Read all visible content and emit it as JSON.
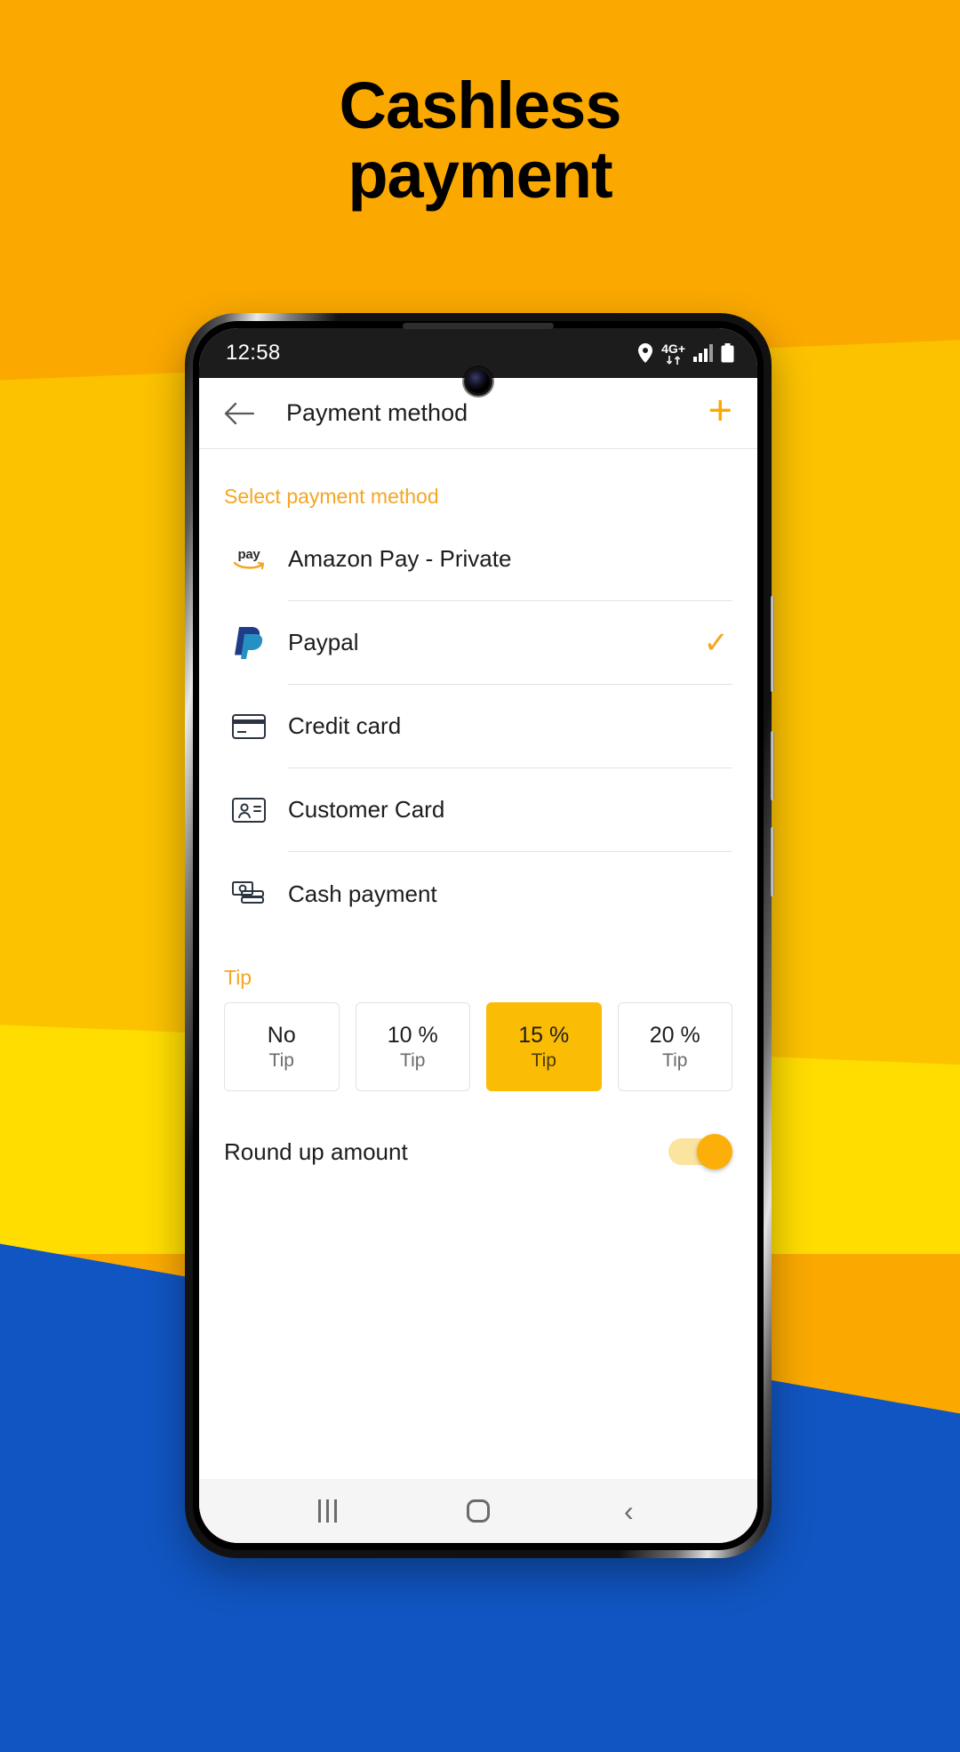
{
  "promo": {
    "headline_line1": "Cashless",
    "headline_line2": "payment",
    "colors": {
      "orange": "#FBA900",
      "gold": "#FCC200",
      "yellow": "#FFDD00",
      "blue": "#1155C2",
      "accent": "#F5A623",
      "tip_selected": "#FBBC05"
    }
  },
  "phone": {
    "statusbar": {
      "time": "12:58",
      "icons": [
        "location-pin-icon",
        "4G+",
        "data-transfer-icon",
        "signal-bars-icon",
        "battery-icon"
      ],
      "network_label": "4G+"
    },
    "appbar": {
      "back_icon": "arrow-left-icon",
      "title": "Payment method",
      "add_label": "+"
    },
    "payment": {
      "section_label": "Select payment method",
      "methods": [
        {
          "label": "Amazon Pay - Private",
          "icon": "amazon-pay-icon",
          "selected": false
        },
        {
          "label": "Paypal",
          "icon": "paypal-icon",
          "selected": true
        },
        {
          "label": "Credit card",
          "icon": "credit-card-icon",
          "selected": false
        },
        {
          "label": "Customer Card",
          "icon": "customer-card-icon",
          "selected": false
        },
        {
          "label": "Cash payment",
          "icon": "cash-icon",
          "selected": false
        }
      ],
      "check_glyph": "✓"
    },
    "tip": {
      "section_label": "Tip",
      "options": [
        {
          "main": "No",
          "sub": "Tip",
          "selected": false
        },
        {
          "main": "10 %",
          "sub": "Tip",
          "selected": false
        },
        {
          "main": "15 %",
          "sub": "Tip",
          "selected": true
        },
        {
          "main": "20 %",
          "sub": "Tip",
          "selected": false
        }
      ]
    },
    "roundup": {
      "label": "Round up amount",
      "enabled": true
    },
    "navbar": {
      "recents_label": "recents-icon",
      "home_label": "home-icon",
      "back_label": "‹"
    }
  }
}
